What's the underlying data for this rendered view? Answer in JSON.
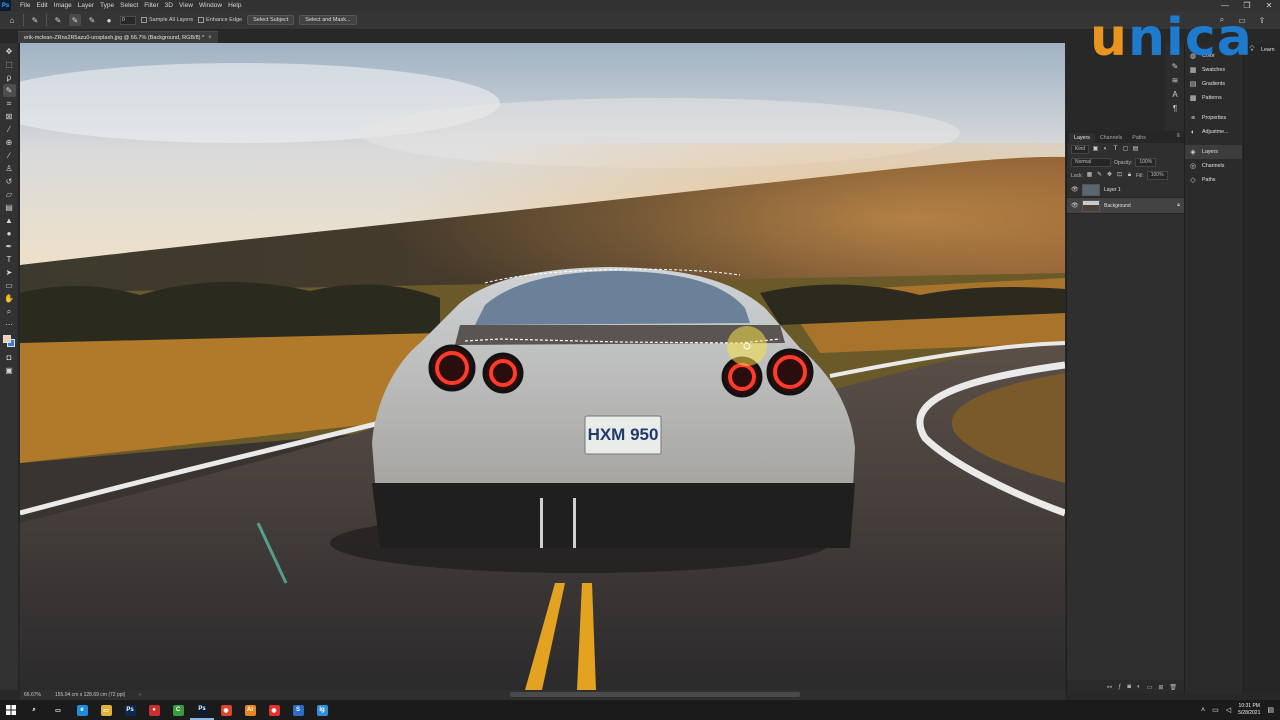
{
  "menubar": {
    "app_logo": "Ps",
    "items": [
      "File",
      "Edit",
      "Image",
      "Layer",
      "Type",
      "Select",
      "Filter",
      "3D",
      "View",
      "Window",
      "Help"
    ],
    "window_controls": [
      "—",
      "❐",
      "✕"
    ]
  },
  "options": {
    "brush_size": "0",
    "sample_all_layers": "Sample All Layers",
    "enhance_edge": "Enhance Edge",
    "select_subject": "Select Subject",
    "select_and_mask": "Select and Mask..."
  },
  "document": {
    "tab_title": "erik-mclean-ZRns2R5azu0-unsplash.jpg @ 66.7% (Background, RGB/8) *",
    "close": "×",
    "plate": "HXM 950"
  },
  "status": {
    "zoom": "66.67%",
    "doc_size": "155.04 cm x 128.69 cm (72 ppi)",
    "arrow": "›"
  },
  "layers_panel": {
    "tabs": [
      "Layers",
      "Channels",
      "Paths"
    ],
    "filter_kind": "Kind",
    "blend_mode": "Normal",
    "opacity_label": "Opacity:",
    "opacity_value": "100%",
    "lock_label": "Lock:",
    "fill_label": "Fill:",
    "fill_value": "100%",
    "layers": [
      {
        "name": "Layer 1",
        "selected": false
      },
      {
        "name": "Background",
        "selected": true
      }
    ]
  },
  "right_dock": {
    "items": [
      "Color",
      "Swatches",
      "Gradients",
      "Patterns",
      "Properties",
      "Adjustme...",
      "Layers",
      "Channels",
      "Paths"
    ],
    "far_items": [
      "Learn"
    ]
  },
  "watermark": {
    "u": "u",
    "rest": "nica"
  },
  "taskbar": {
    "apps": [
      {
        "name": "edge",
        "label": "e",
        "color": "#1e8fd6"
      },
      {
        "name": "file-explorer",
        "label": "▭",
        "color": "#e0b23b"
      },
      {
        "name": "photoshop-task",
        "label": "Ps",
        "color": "#0b2a52"
      },
      {
        "name": "record",
        "label": "●",
        "color": "#c9302c"
      },
      {
        "name": "camtasia",
        "label": "C",
        "color": "#3b9b44"
      },
      {
        "name": "photoshop-active",
        "label": "Ps",
        "color": "#0b1c33"
      },
      {
        "name": "chrome",
        "label": "◉",
        "color": "#d9452f"
      },
      {
        "name": "illustrator",
        "label": "Ai",
        "color": "#e8861f"
      },
      {
        "name": "recorder",
        "label": "◉",
        "color": "#d33"
      },
      {
        "name": "scheduler",
        "label": "S",
        "color": "#2c6fc9"
      },
      {
        "name": "ig",
        "label": "Ig",
        "color": "#2f8fd8"
      }
    ],
    "time": "10:31 PM",
    "date": "5/28/2021"
  },
  "colors": {
    "accent": "#31a8ff",
    "watermark_orange": "#f39a1e",
    "watermark_blue": "#1e7fd6"
  }
}
